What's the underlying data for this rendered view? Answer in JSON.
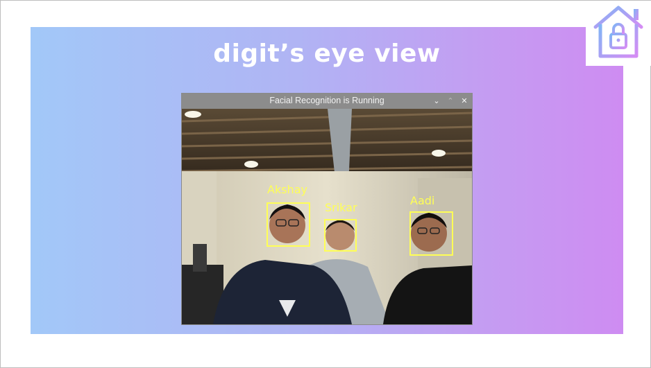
{
  "slide": {
    "title": "digit’s eye view"
  },
  "logo": {
    "icon": "house-lock-icon",
    "colors": [
      "#7fb5f5",
      "#d58cf4"
    ]
  },
  "window": {
    "title": "Facial Recognition is Running",
    "controls": {
      "minimize_icon": "chevron-down-icon",
      "maximize_icon": "chevron-up-icon",
      "close_icon": "close-icon",
      "minimize_glyph": "⌄",
      "maximize_glyph": "⌃",
      "close_glyph": "✕"
    }
  },
  "faces": [
    {
      "name": "Akshay"
    },
    {
      "name": "Srikar"
    },
    {
      "name": "Aadi"
    }
  ],
  "colors": {
    "detection_box": "#ffff55",
    "gradient_start": "#a2c8f8",
    "gradient_end": "#ce8cf2"
  }
}
